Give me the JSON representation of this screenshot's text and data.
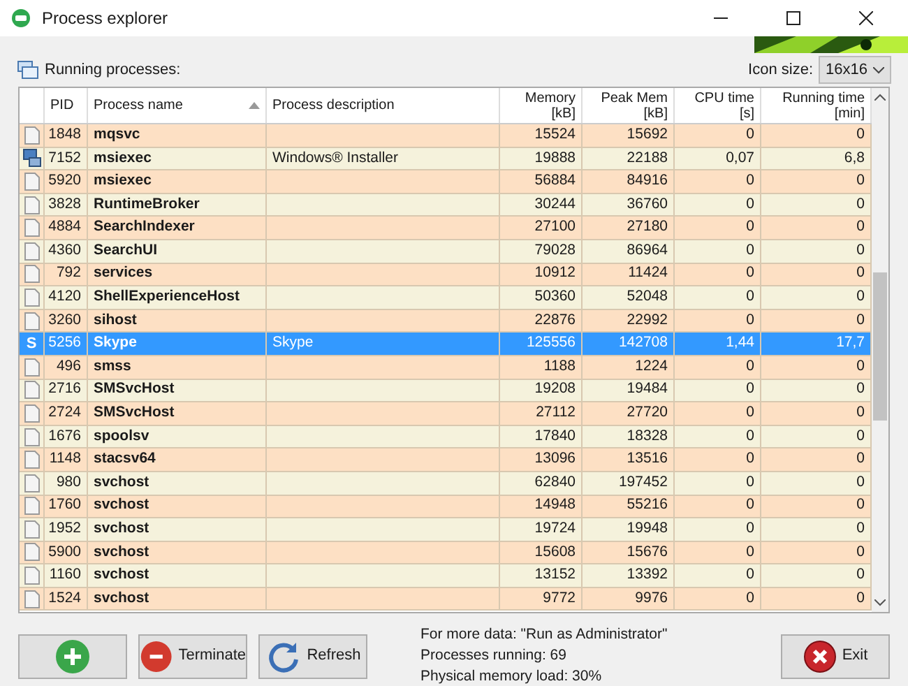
{
  "window": {
    "title": "Process explorer"
  },
  "panel": {
    "title": "Running processes:",
    "icon_size_label": "Icon size:",
    "icon_size_value": "16x16"
  },
  "table": {
    "columns": [
      {
        "label": "PID"
      },
      {
        "label": "Process name",
        "sorted": true
      },
      {
        "label": "Process description"
      },
      {
        "label": "Memory\n[kB]"
      },
      {
        "label": "Peak Mem\n[kB]"
      },
      {
        "label": "CPU time\n[s]"
      },
      {
        "label": "Running time\n[min]"
      }
    ],
    "rows": [
      {
        "kind": "file",
        "pid": "1848",
        "name": "mqsvc",
        "description": "",
        "memory": "15524",
        "peak": "15692",
        "cpu": "0",
        "running": "0",
        "selected": false
      },
      {
        "kind": "installer",
        "pid": "7152",
        "name": "msiexec",
        "description": "Windows® Installer",
        "memory": "19888",
        "peak": "22188",
        "cpu": "0,07",
        "running": "6,8",
        "selected": false
      },
      {
        "kind": "file",
        "pid": "5920",
        "name": "msiexec",
        "description": "",
        "memory": "56884",
        "peak": "84916",
        "cpu": "0",
        "running": "0",
        "selected": false
      },
      {
        "kind": "file",
        "pid": "3828",
        "name": "RuntimeBroker",
        "description": "",
        "memory": "30244",
        "peak": "36760",
        "cpu": "0",
        "running": "0",
        "selected": false
      },
      {
        "kind": "file",
        "pid": "4884",
        "name": "SearchIndexer",
        "description": "",
        "memory": "27100",
        "peak": "27180",
        "cpu": "0",
        "running": "0",
        "selected": false
      },
      {
        "kind": "file",
        "pid": "4360",
        "name": "SearchUI",
        "description": "",
        "memory": "79028",
        "peak": "86964",
        "cpu": "0",
        "running": "0",
        "selected": false
      },
      {
        "kind": "file",
        "pid": "792",
        "name": "services",
        "description": "",
        "memory": "10912",
        "peak": "11424",
        "cpu": "0",
        "running": "0",
        "selected": false
      },
      {
        "kind": "file",
        "pid": "4120",
        "name": "ShellExperienceHost",
        "description": "",
        "memory": "50360",
        "peak": "52048",
        "cpu": "0",
        "running": "0",
        "selected": false
      },
      {
        "kind": "file",
        "pid": "3260",
        "name": "sihost",
        "description": "",
        "memory": "22876",
        "peak": "22992",
        "cpu": "0",
        "running": "0",
        "selected": false
      },
      {
        "kind": "letter",
        "icon_text": "S",
        "pid": "5256",
        "name": "Skype",
        "description": "Skype",
        "memory": "125556",
        "peak": "142708",
        "cpu": "1,44",
        "running": "17,7",
        "selected": true
      },
      {
        "kind": "file",
        "pid": "496",
        "name": "smss",
        "description": "",
        "memory": "1188",
        "peak": "1224",
        "cpu": "0",
        "running": "0",
        "selected": false
      },
      {
        "kind": "file",
        "pid": "2716",
        "name": "SMSvcHost",
        "description": "",
        "memory": "19208",
        "peak": "19484",
        "cpu": "0",
        "running": "0",
        "selected": false
      },
      {
        "kind": "file",
        "pid": "2724",
        "name": "SMSvcHost",
        "description": "",
        "memory": "27112",
        "peak": "27720",
        "cpu": "0",
        "running": "0",
        "selected": false
      },
      {
        "kind": "file",
        "pid": "1676",
        "name": "spoolsv",
        "description": "",
        "memory": "17840",
        "peak": "18328",
        "cpu": "0",
        "running": "0",
        "selected": false
      },
      {
        "kind": "file",
        "pid": "1148",
        "name": "stacsv64",
        "description": "",
        "memory": "13096",
        "peak": "13516",
        "cpu": "0",
        "running": "0",
        "selected": false
      },
      {
        "kind": "file",
        "pid": "980",
        "name": "svchost",
        "description": "",
        "memory": "62840",
        "peak": "197452",
        "cpu": "0",
        "running": "0",
        "selected": false
      },
      {
        "kind": "file",
        "pid": "1760",
        "name": "svchost",
        "description": "",
        "memory": "14948",
        "peak": "55216",
        "cpu": "0",
        "running": "0",
        "selected": false
      },
      {
        "kind": "file",
        "pid": "1952",
        "name": "svchost",
        "description": "",
        "memory": "19724",
        "peak": "19948",
        "cpu": "0",
        "running": "0",
        "selected": false
      },
      {
        "kind": "file",
        "pid": "5900",
        "name": "svchost",
        "description": "",
        "memory": "15608",
        "peak": "15676",
        "cpu": "0",
        "running": "0",
        "selected": false
      },
      {
        "kind": "file",
        "pid": "1160",
        "name": "svchost",
        "description": "",
        "memory": "13152",
        "peak": "13392",
        "cpu": "0",
        "running": "0",
        "selected": false
      },
      {
        "kind": "file",
        "pid": "1524",
        "name": "svchost",
        "description": "",
        "memory": "9772",
        "peak": "9976",
        "cpu": "0",
        "running": "0",
        "selected": false
      }
    ]
  },
  "buttons": [
    {
      "kind": "add"
    },
    {
      "kind": "terminate",
      "label": "Terminate"
    },
    {
      "kind": "refresh",
      "label": "Refresh"
    }
  ],
  "status": [
    "For more data: \"Run as Administrator\"",
    "Processes running: 69",
    "Physical memory load: 30%"
  ],
  "exit_button": {
    "label": "Exit"
  }
}
